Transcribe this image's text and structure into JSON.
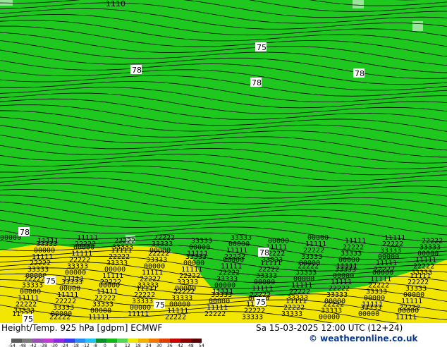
{
  "map": {
    "colors": {
      "green": "#1fc81f",
      "light_green": "#9be29b",
      "yellow": "#f2e600",
      "contour": "#000000"
    },
    "contour_labels": [
      "75",
      "78",
      "78",
      "78",
      "78",
      "78",
      "75",
      "75",
      "75",
      "75"
    ],
    "edge_label": "1110"
  },
  "footer": {
    "title": "Height/Temp. 925 hPa [gdpm] ECMWF",
    "datetime": "Sa 15-03-2025 12:00 UTC (12+24)",
    "copyright": "© weatheronline.co.uk"
  },
  "color_scale": {
    "ticks": [
      "-54",
      "-48",
      "-42",
      "-38",
      "-30",
      "-24",
      "-18",
      "-12",
      "-8",
      "0",
      "8",
      "12",
      "18",
      "24",
      "30",
      "36",
      "42",
      "48",
      "54"
    ],
    "colors": [
      "#5a5a5a",
      "#7a7a7a",
      "#9a4fb5",
      "#c23ccf",
      "#8a2be2",
      "#3b3bf0",
      "#2a8cf0",
      "#22c3ef",
      "#0a8f2a",
      "#14b814",
      "#56d456",
      "#e8e800",
      "#f0b000",
      "#f07800",
      "#e03c00",
      "#c80000",
      "#8a0000",
      "#5a0000"
    ]
  }
}
